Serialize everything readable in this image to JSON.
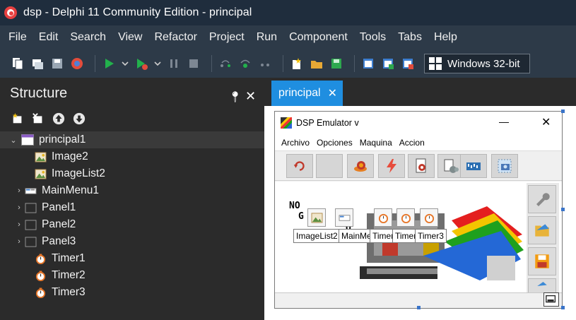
{
  "titlebar": {
    "title": "dsp - Delphi 11 Community Edition - principal"
  },
  "menubar": {
    "items": [
      "File",
      "Edit",
      "Search",
      "View",
      "Refactor",
      "Project",
      "Run",
      "Component",
      "Tools",
      "Tabs",
      "Help"
    ]
  },
  "toolbar": {
    "platform": "Windows 32-bit"
  },
  "structure": {
    "title": "Structure",
    "tree": {
      "root": "principal1",
      "children": [
        "Image2",
        "ImageList2",
        "MainMenu1",
        "Panel1",
        "Panel2",
        "Panel3",
        "Timer1",
        "Timer2",
        "Timer3"
      ]
    }
  },
  "editor": {
    "tab": "principal",
    "form": {
      "title": "DSP Emulator v",
      "menu": [
        "Archivo",
        "Opciones",
        "Maquina",
        "Accion"
      ],
      "logo_lines": [
        "NO",
        "G",
        "O"
      ],
      "components": [
        "ImageList2",
        "MainMenu1",
        "Timer1",
        "Timer2",
        "Timer3"
      ]
    }
  },
  "colors": {
    "accent": "#1f8ee0",
    "titlebar": "#1f2d3d",
    "menubar": "#2d3a48",
    "pane": "#2b2b2b"
  }
}
